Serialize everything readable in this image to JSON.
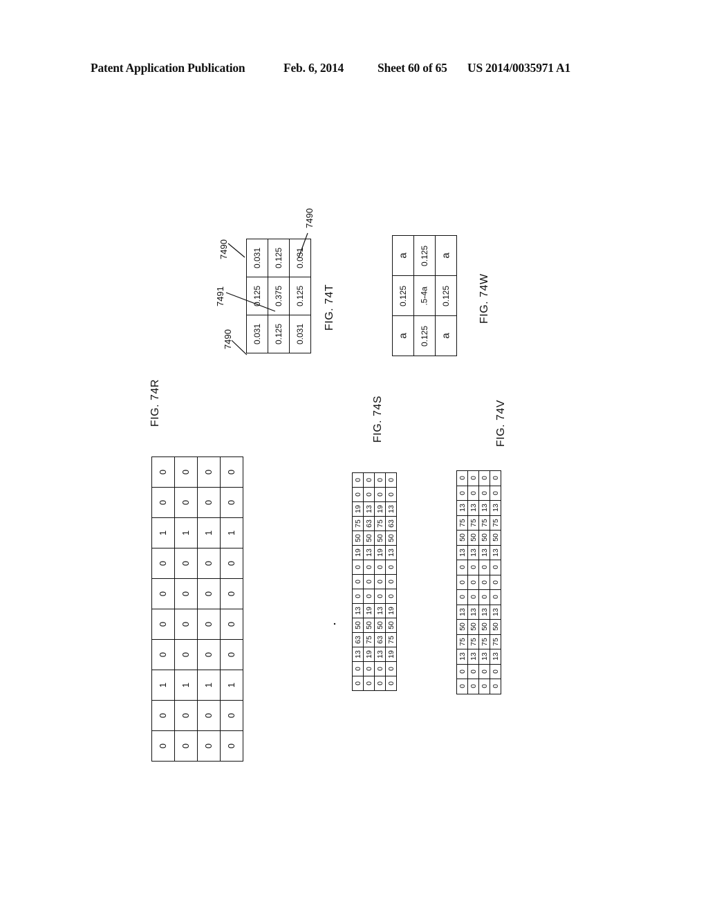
{
  "header": {
    "publication": "Patent Application Publication",
    "date": "Feb. 6, 2014",
    "sheet": "Sheet 60 of 65",
    "number": "US 2014/0035971 A1"
  },
  "figures": {
    "fig74r": {
      "label": "FIG. 74R",
      "rows": [
        [
          "0",
          "0",
          "0",
          "0"
        ],
        [
          "0",
          "0",
          "0",
          "0"
        ],
        [
          "1",
          "1",
          "1",
          "1"
        ],
        [
          "0",
          "0",
          "0",
          "0"
        ],
        [
          "0",
          "0",
          "0",
          "0"
        ],
        [
          "0",
          "0",
          "0",
          "0"
        ],
        [
          "0",
          "0",
          "0",
          "0"
        ],
        [
          "1",
          "1",
          "1",
          "1"
        ],
        [
          "0",
          "0",
          "0",
          "0"
        ],
        [
          "0",
          "0",
          "0",
          "0"
        ]
      ]
    },
    "fig74s": {
      "label": "FIG. 74S",
      "rows": [
        [
          "0",
          "0",
          "0",
          "0"
        ],
        [
          "0",
          "0",
          "0",
          "0"
        ],
        [
          "19",
          "13",
          "19",
          "13"
        ],
        [
          "75",
          "63",
          "75",
          "63"
        ],
        [
          "50",
          "50",
          "50",
          "50"
        ],
        [
          "19",
          "13",
          "19",
          "13"
        ],
        [
          "0",
          "0",
          "0",
          "0"
        ],
        [
          "0",
          "0",
          "0",
          "0"
        ],
        [
          "0",
          "0",
          "0",
          "0"
        ],
        [
          "13",
          "19",
          "13",
          "19"
        ],
        [
          "50",
          "50",
          "50",
          "50"
        ],
        [
          "63",
          "75",
          "63",
          "75"
        ],
        [
          "13",
          "19",
          "13",
          "19"
        ],
        [
          "0",
          "0",
          "0",
          "0"
        ],
        [
          "0",
          "0",
          "0",
          "0"
        ]
      ]
    },
    "fig74v": {
      "label": "FIG. 74V",
      "rows": [
        [
          "0",
          "0",
          "0",
          "0"
        ],
        [
          "0",
          "0",
          "0",
          "0"
        ],
        [
          "13",
          "13",
          "13",
          "13"
        ],
        [
          "75",
          "75",
          "75",
          "75"
        ],
        [
          "50",
          "50",
          "50",
          "50"
        ],
        [
          "13",
          "13",
          "13",
          "13"
        ],
        [
          "0",
          "0",
          "0",
          "0"
        ],
        [
          "0",
          "0",
          "0",
          "0"
        ],
        [
          "0",
          "0",
          "0",
          "0"
        ],
        [
          "13",
          "13",
          "13",
          "13"
        ],
        [
          "50",
          "50",
          "50",
          "50"
        ],
        [
          "75",
          "75",
          "75",
          "75"
        ],
        [
          "13",
          "13",
          "13",
          "13"
        ],
        [
          "0",
          "0",
          "0",
          "0"
        ],
        [
          "0",
          "0",
          "0",
          "0"
        ]
      ]
    },
    "fig74t": {
      "label": "FIG. 74T",
      "rows": [
        [
          "0.031",
          "0.125",
          "0.031"
        ],
        [
          "0.125",
          "0.375",
          "0.125"
        ],
        [
          "0.031",
          "0.125",
          "0.031"
        ]
      ],
      "refs": {
        "corner_top": "7490",
        "center": "7491",
        "corner_bottom_left": "7490",
        "corner_right": "7490"
      }
    },
    "fig74w": {
      "label": "FIG. 74W",
      "rows": [
        [
          "a",
          "0.125",
          "a"
        ],
        [
          "0.125",
          ".5-4a",
          "0.125"
        ],
        [
          "a",
          "0.125",
          "a"
        ]
      ]
    }
  }
}
